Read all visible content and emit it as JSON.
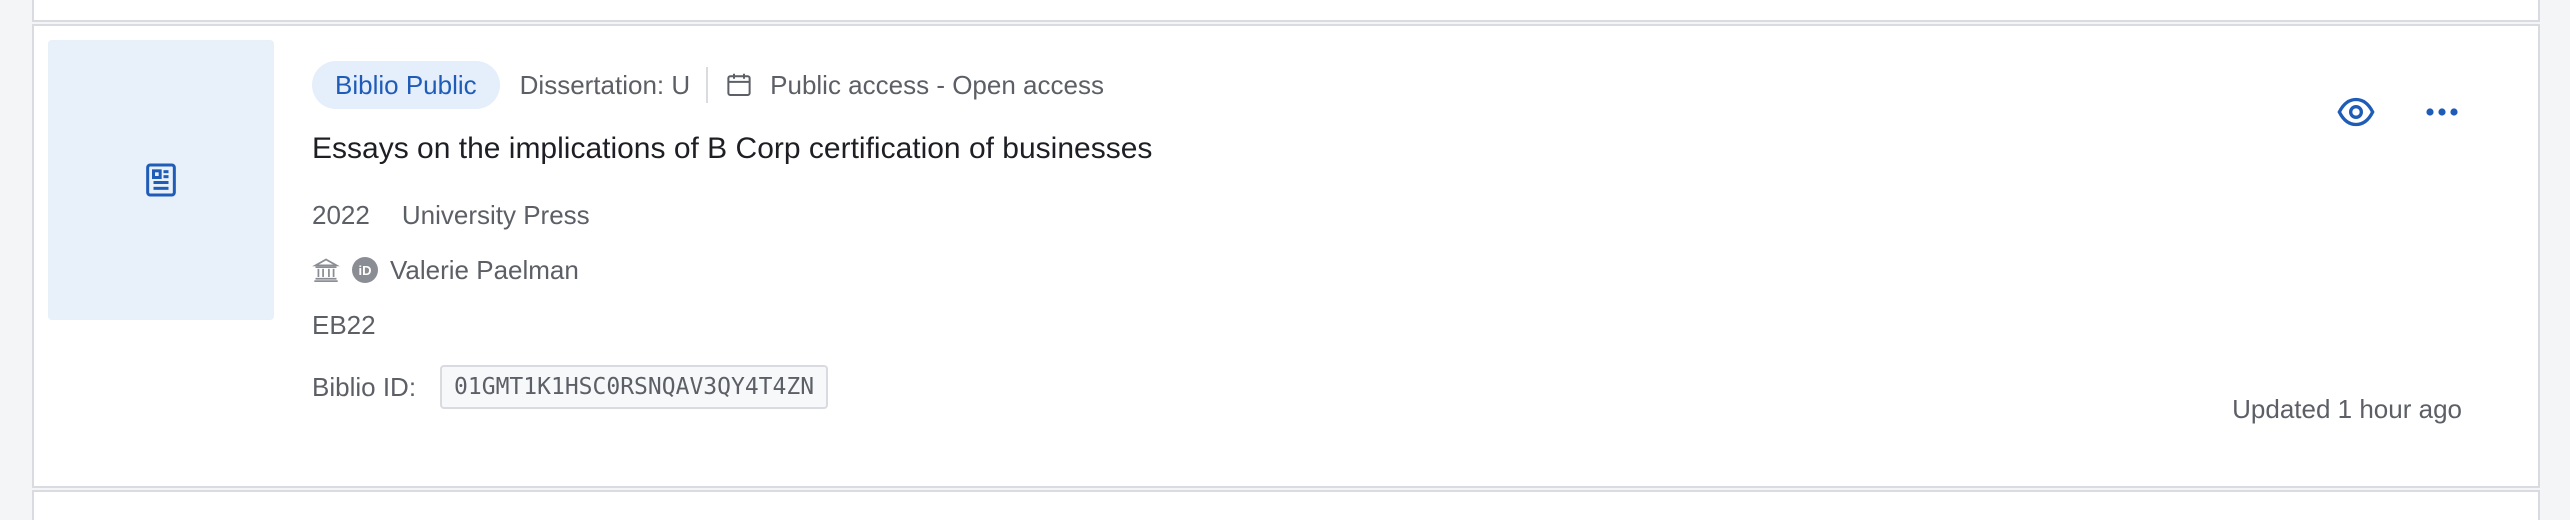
{
  "colors": {
    "accent": "#1f5cb8",
    "badge_bg": "#e5eefb",
    "thumb_bg": "#e8f0fa",
    "muted_text": "#5c5f66",
    "title_text": "#1d1f24",
    "border": "#d9dbe0"
  },
  "record": {
    "thumbnail_icon": "document-icon",
    "badge": "Biblio Public",
    "type": "Dissertation: U",
    "access_icon": "calendar-icon",
    "access": "Public access - Open access",
    "title": "Essays on the implications of B Corp certification of businesses",
    "year": "2022",
    "publisher": "University Press",
    "affiliation_icon": "institution-icon",
    "orcid_icon": "orcid-icon",
    "orcid_label": "iD",
    "author": "Valerie Paelman",
    "department": "EB22",
    "biblio_id_label": "Biblio ID:",
    "biblio_id": "01GMT1K1HSC0RSNQAV3QY4T4ZN",
    "updated": "Updated 1 hour ago"
  },
  "actions": {
    "view_icon": "eye-icon",
    "more_icon": "more-horizontal-icon"
  }
}
